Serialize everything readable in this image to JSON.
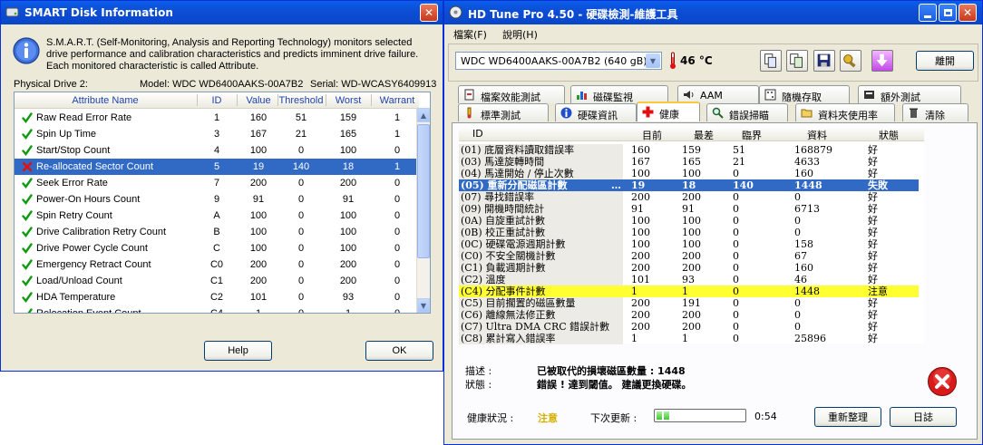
{
  "smart": {
    "title": "SMART Disk Information",
    "description": "S.M.A.R.T. (Self-Monitoring, Analysis and Reporting Technology) monitors selected drive performance and calibration characteristics and predicts imminent drive failure. Each monitored characteristic is called Attribute.",
    "drive_label": "Physical Drive 2:",
    "model": "Model: WDC WD6400AAKS-00A7B2",
    "serial": "Serial: WD-WCASY6409913",
    "columns": [
      "Attribute Name",
      "ID",
      "Value",
      "Threshold",
      "Worst",
      "Warrant"
    ],
    "rows": [
      {
        "name": "Raw Read Error Rate",
        "id": "1",
        "value": "160",
        "threshold": "51",
        "worst": "159",
        "warrant": "1",
        "status": "ok"
      },
      {
        "name": "Spin Up Time",
        "id": "3",
        "value": "167",
        "threshold": "21",
        "worst": "165",
        "warrant": "1",
        "status": "ok"
      },
      {
        "name": "Start/Stop Count",
        "id": "4",
        "value": "100",
        "threshold": "0",
        "worst": "100",
        "warrant": "0",
        "status": "ok"
      },
      {
        "name": "Re-allocated Sector Count",
        "id": "5",
        "value": "19",
        "threshold": "140",
        "worst": "18",
        "warrant": "1",
        "status": "fail"
      },
      {
        "name": "Seek Error Rate",
        "id": "7",
        "value": "200",
        "threshold": "0",
        "worst": "200",
        "warrant": "0",
        "status": "ok"
      },
      {
        "name": "Power-On Hours Count",
        "id": "9",
        "value": "91",
        "threshold": "0",
        "worst": "91",
        "warrant": "0",
        "status": "ok"
      },
      {
        "name": "Spin Retry Count",
        "id": "A",
        "value": "100",
        "threshold": "0",
        "worst": "100",
        "warrant": "0",
        "status": "ok"
      },
      {
        "name": "Drive Calibration Retry Count",
        "id": "B",
        "value": "100",
        "threshold": "0",
        "worst": "100",
        "warrant": "0",
        "status": "ok"
      },
      {
        "name": "Drive Power Cycle Count",
        "id": "C",
        "value": "100",
        "threshold": "0",
        "worst": "100",
        "warrant": "0",
        "status": "ok"
      },
      {
        "name": "Emergency Retract Count",
        "id": "C0",
        "value": "200",
        "threshold": "0",
        "worst": "200",
        "warrant": "0",
        "status": "ok"
      },
      {
        "name": "Load/Unload Count",
        "id": "C1",
        "value": "200",
        "threshold": "0",
        "worst": "200",
        "warrant": "0",
        "status": "ok"
      },
      {
        "name": "HDA Temperature",
        "id": "C2",
        "value": "101",
        "threshold": "0",
        "worst": "93",
        "warrant": "0",
        "status": "ok"
      },
      {
        "name": "Relocation Event Count",
        "id": "C4",
        "value": "1",
        "threshold": "0",
        "worst": "1",
        "warrant": "0",
        "status": "ok"
      }
    ],
    "help_label": "Help",
    "ok_label": "OK",
    "close_glyph": "✕"
  },
  "hdtune": {
    "title": "HD Tune Pro 4.50 - 硬碟檢測-維護工具",
    "menu": [
      "檔案(F)",
      "說明(H)"
    ],
    "drive_select": "WDC WD6400AAKS-00A7B2 (640 gB)",
    "temperature": "46 °C",
    "exit_label": "離開",
    "tabs_top": [
      "檔案效能測試",
      "磁碟監視",
      "AAM",
      "隨機存取",
      "額外測試"
    ],
    "tabs_bottom": [
      "標準測試",
      "硬碟資訊",
      "健康",
      "錯誤掃瞄",
      "資料夾使用率",
      "清除"
    ],
    "columns": [
      "ID",
      "目前",
      "最差",
      "臨界",
      "資料",
      "狀態"
    ],
    "rows": [
      {
        "id": "(01) 底層資料讀取錯誤率",
        "cur": "160",
        "worst": "159",
        "thr": "51",
        "data": "168879",
        "status": "好",
        "hl": ""
      },
      {
        "id": "(03) 馬達旋轉時間",
        "cur": "167",
        "worst": "165",
        "thr": "21",
        "data": "4633",
        "status": "好",
        "hl": ""
      },
      {
        "id": "(04) 馬達開始 / 停止次數",
        "cur": "100",
        "worst": "100",
        "thr": "0",
        "data": "160",
        "status": "好",
        "hl": ""
      },
      {
        "id": "(05) 重新分配磁區計數",
        "cur": "19",
        "worst": "18",
        "thr": "140",
        "data": "1448",
        "status": "失敗",
        "hl": "sel"
      },
      {
        "id": "(07) 尋找錯誤率",
        "cur": "200",
        "worst": "200",
        "thr": "0",
        "data": "0",
        "status": "好",
        "hl": ""
      },
      {
        "id": "(09) 開機時間統計",
        "cur": "91",
        "worst": "91",
        "thr": "0",
        "data": "6713",
        "status": "好",
        "hl": ""
      },
      {
        "id": "(0A) 自旋重試計數",
        "cur": "100",
        "worst": "100",
        "thr": "0",
        "data": "0",
        "status": "好",
        "hl": ""
      },
      {
        "id": "(0B) 校正重試計數",
        "cur": "100",
        "worst": "100",
        "thr": "0",
        "data": "0",
        "status": "好",
        "hl": ""
      },
      {
        "id": "(0C) 硬碟電源週期計數",
        "cur": "100",
        "worst": "100",
        "thr": "0",
        "data": "158",
        "status": "好",
        "hl": ""
      },
      {
        "id": "(C0) 不安全關機計數",
        "cur": "200",
        "worst": "200",
        "thr": "0",
        "data": "67",
        "status": "好",
        "hl": ""
      },
      {
        "id": "(C1) 負載週期計數",
        "cur": "200",
        "worst": "200",
        "thr": "0",
        "data": "160",
        "status": "好",
        "hl": ""
      },
      {
        "id": "(C2) 溫度",
        "cur": "101",
        "worst": "93",
        "thr": "0",
        "data": "46",
        "status": "好",
        "hl": ""
      },
      {
        "id": "(C4) 分配事件計數",
        "cur": "1",
        "worst": "1",
        "thr": "0",
        "data": "1448",
        "status": "注意",
        "hl": "warn"
      },
      {
        "id": "(C5) 目前擱置的磁區數量",
        "cur": "200",
        "worst": "191",
        "thr": "0",
        "data": "0",
        "status": "好",
        "hl": ""
      },
      {
        "id": "(C6) 離線無法修正數",
        "cur": "200",
        "worst": "200",
        "thr": "0",
        "data": "0",
        "status": "好",
        "hl": ""
      },
      {
        "id": "(C7) Ultra DMA CRC 錯誤計數",
        "cur": "200",
        "worst": "200",
        "thr": "0",
        "data": "0",
        "status": "好",
        "hl": ""
      },
      {
        "id": "(C8) 累計寫入錯誤率",
        "cur": "1",
        "worst": "1",
        "thr": "0",
        "data": "25896",
        "status": "好",
        "hl": ""
      }
    ],
    "desc_label": "描述 :",
    "desc_value": "已被取代的損壞磁區數量 : 1448",
    "state_label": "狀態 :",
    "state_value": "錯誤 ! 達到閾值。 建議更換硬碟。",
    "health_label": "健康狀況 :",
    "health_value": "注意",
    "next_update_label": "下次更新 :",
    "next_update_time": "0:54",
    "next_update_progress": 0.18,
    "refresh_label": "重新整理",
    "log_label": "日誌",
    "colors": {
      "selected": "#316ac5",
      "warning": "#ffff32",
      "health_warning": "#d4b000"
    }
  }
}
